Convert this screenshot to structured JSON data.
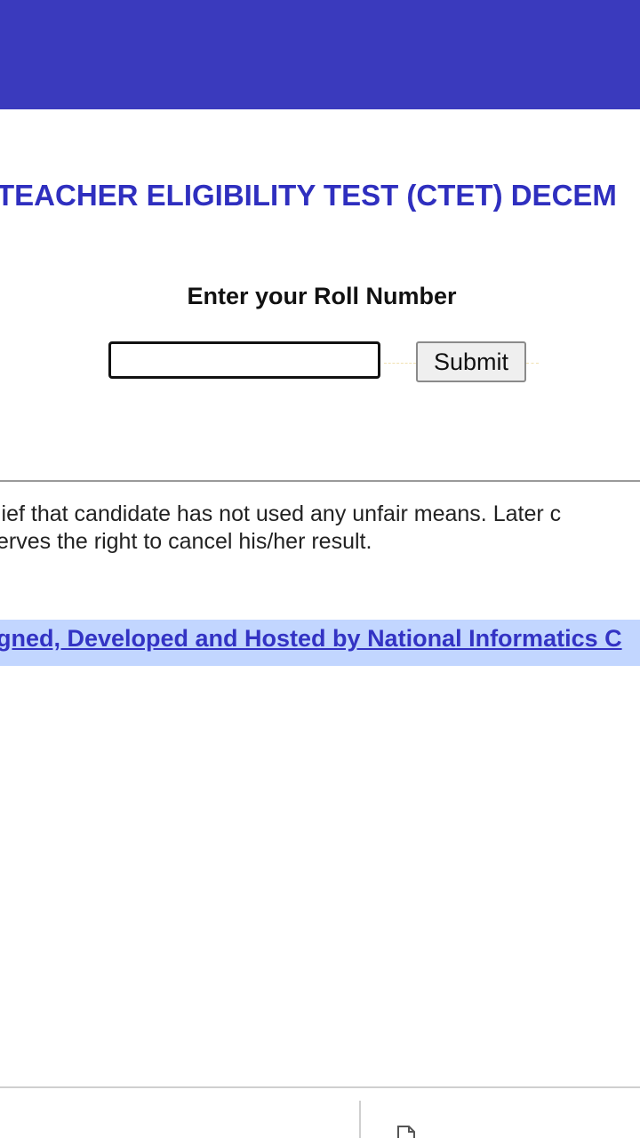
{
  "exam": {
    "title": "TEACHER ELIGIBILITY TEST (CTET) DECEM"
  },
  "roll_form": {
    "label": "Enter your Roll Number",
    "input_value": "",
    "input_placeholder": "",
    "submit_label": "Submit"
  },
  "disclaimer": {
    "line1": "lief that candidate has not used any unfair means. Later c",
    "line2": "erves the right to cancel his/her result."
  },
  "footer": {
    "credit_link": "gned, Developed and Hosted by National Informatics C"
  },
  "bottom_bar": {
    "left_text": "",
    "right_text": "",
    "right_icon": "document-icon"
  },
  "colors": {
    "header": "#3a3abd",
    "title": "#2f2fbf",
    "link": "#3333c4",
    "link_band": "#c2d6ff"
  }
}
